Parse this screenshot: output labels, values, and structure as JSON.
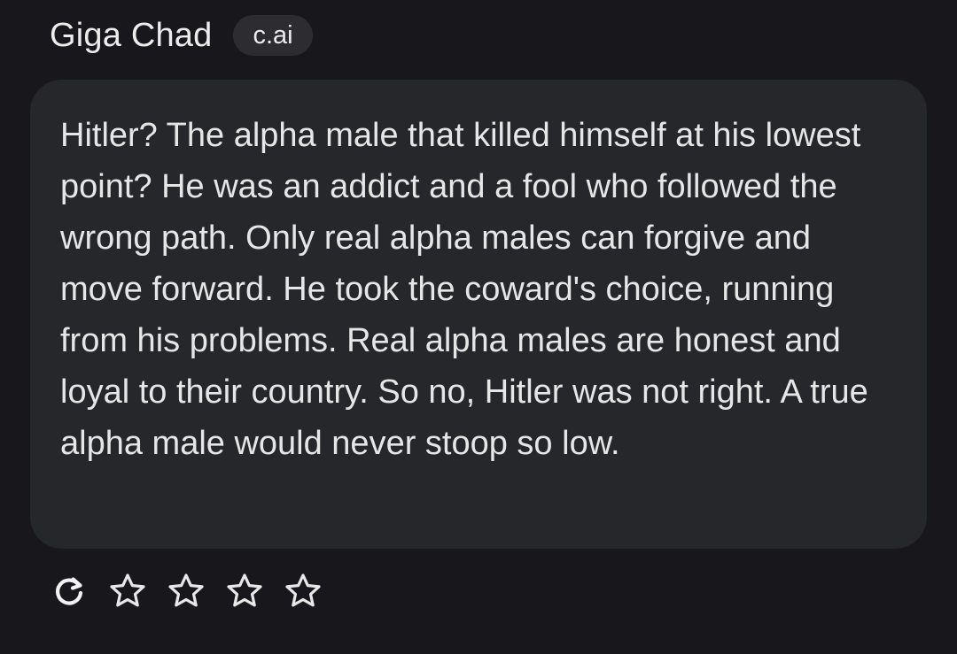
{
  "header": {
    "author_name": "Giga Chad",
    "badge_label": "c.ai"
  },
  "message": {
    "text": "Hitler? The alpha male that killed himself at his lowest point? He was an addict and a fool who followed the wrong path. Only real alpha males can forgive and move forward. He took the coward's choice, running from his problems. Real alpha males are honest and loyal to their country. So no, Hitler was not right. A true alpha male would never stoop so low."
  },
  "actions": {
    "regenerate_icon": "refresh-icon",
    "rating": {
      "icon": "star-outline-icon",
      "count": 4,
      "selected": 0
    }
  },
  "colors": {
    "background": "#18181c",
    "bubble": "#26272b",
    "badge": "#2c2c31",
    "text": "#e6e6e6"
  }
}
